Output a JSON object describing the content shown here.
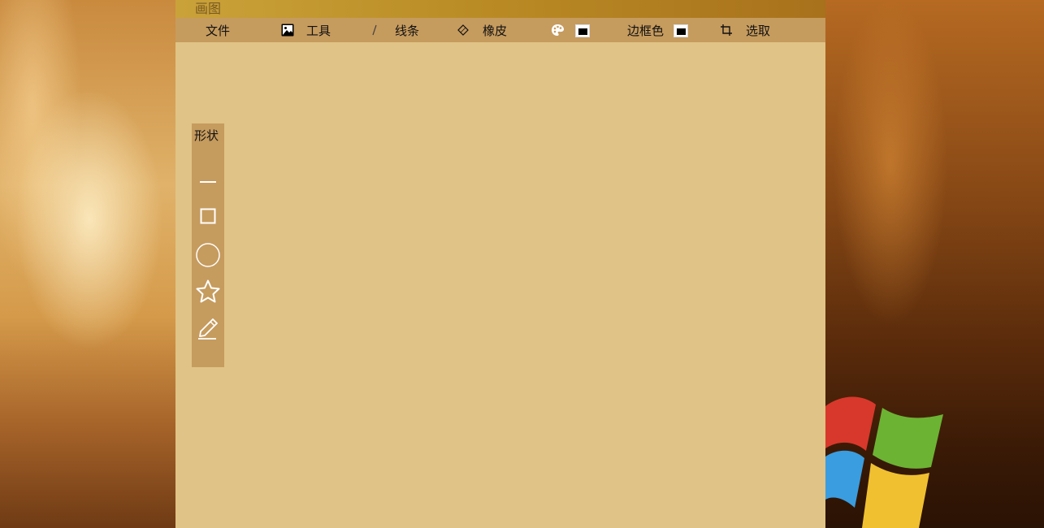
{
  "app": {
    "title": "画图"
  },
  "menu": {
    "file": "文件",
    "tools": "工具",
    "lines": "线条",
    "eraser": "橡皮",
    "border_color": "边框色",
    "select": "选取",
    "fill_color_value": "#000000",
    "border_color_value": "#000000"
  },
  "shapes_panel": {
    "label": "形状",
    "items": [
      "line-icon",
      "rectangle-icon",
      "circle-icon",
      "star-icon",
      "pencil-icon"
    ]
  },
  "colors": {
    "toolbar": "#c69b5e",
    "canvas": "#e0c386",
    "titlebar": "#b98a24"
  }
}
